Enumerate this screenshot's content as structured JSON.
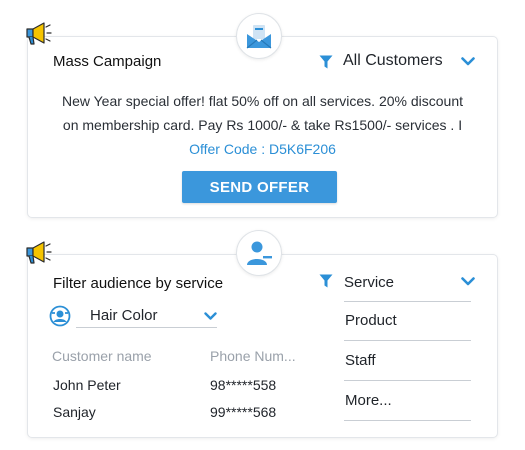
{
  "icons": {
    "megaphone": "megaphone-icon",
    "envelope": "envelope-icon",
    "user": "user-icon",
    "filter": "filter-icon",
    "chevron": "chevron-down-icon",
    "service": "service-icon"
  },
  "colors": {
    "accent": "#3b97dc",
    "link": "#2b8fd6",
    "megaphone_yellow": "#f5c400"
  },
  "mass_campaign": {
    "title": "Mass Campaign",
    "audience_select": "All Customers",
    "message_main": "New Year special offer! flat 50% off on all services. 20% discount on membership card. Pay Rs 1000/- & take Rs1500/- services . I ",
    "offer_code": "Offer Code : D5K6F206",
    "send_button": "SEND OFFER"
  },
  "filter_service": {
    "title": "Filter audience by service",
    "service_select": "Hair Color",
    "columns": [
      "Customer name",
      "Phone Num..."
    ],
    "rows": [
      {
        "name": "John Peter",
        "phone": "98*****558"
      },
      {
        "name": "Sanjay",
        "phone": "99*****568"
      }
    ],
    "dropdown": {
      "label": "Service",
      "options": [
        "Product",
        "Staff",
        "More..."
      ]
    }
  }
}
